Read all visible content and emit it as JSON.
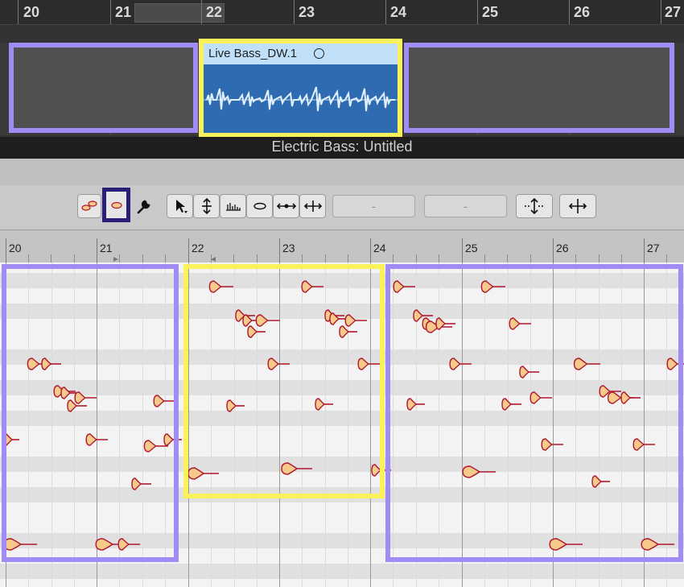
{
  "arrange": {
    "bar_numbers": [
      "20",
      "21",
      "22",
      "23",
      "24",
      "25",
      "26",
      "27"
    ],
    "region_name": "Live Bass_DW.1",
    "track_title": "Electric Bass: Untitled"
  },
  "toolbar": {
    "field1_value": "-",
    "field2_value": "-"
  },
  "piano_roll": {
    "bar_numbers": [
      "20",
      "21",
      "22",
      "23",
      "24",
      "25",
      "26",
      "27"
    ]
  },
  "colors": {
    "selection_highlight": "#fbf15a",
    "neighbor_highlight": "#a18cf5",
    "active_tool_outline": "#2a1f78",
    "region_blue": "#2f6bb0",
    "region_header": "#bfe0f8",
    "note_fill": "#f7c98a",
    "note_edge": "#b0182d"
  }
}
